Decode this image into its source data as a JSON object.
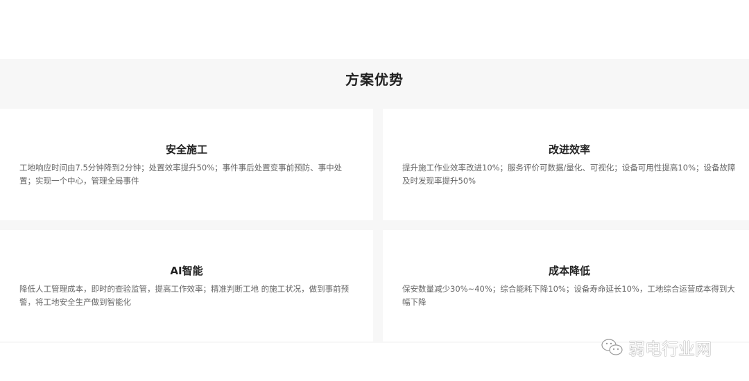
{
  "section": {
    "title": "方案优势"
  },
  "cards": [
    {
      "title": "安全施工",
      "body": "工地响应时间由7.5分钟降到2分钟；处置效率提升50%；事件事后处置变事前预防、事中处置；实现一个中心，管理全局事件"
    },
    {
      "title": "改进效率",
      "body": "提升施工作业效率改进10%；服务评价可数据/量化、可视化；设备可用性提高10%；设备故障及时发现率提升50%"
    },
    {
      "title": "AI智能",
      "body": "降低人工管理成本，即时的查验监管，提高工作效率；精准判断工地 的施工状况，做到事前预警，将工地安全生产做到智能化"
    },
    {
      "title": "成本降低",
      "body": "保安数量减少30%~40%；综合能耗下降10%；设备寿命延长10%，工地综合运营成本得到大幅下降"
    }
  ],
  "watermark": {
    "text": "弱电行业网",
    "icon": "wechat-icon"
  }
}
